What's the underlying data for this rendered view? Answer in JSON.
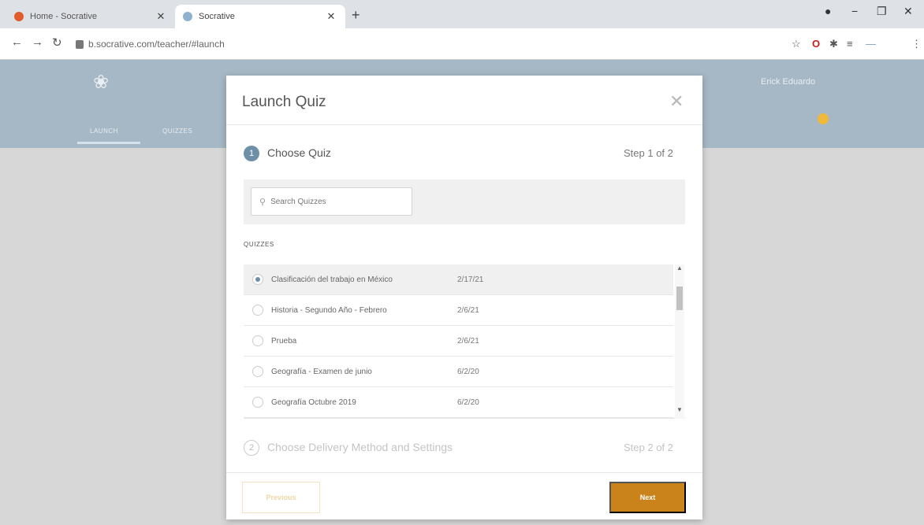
{
  "browser": {
    "tabs": [
      {
        "title": "Home - Socrative",
        "favicon_color": "#e05c2c"
      },
      {
        "title": "Socrative",
        "favicon_color": "#8fb3cf"
      }
    ],
    "url": "b.socrative.com/teacher/#launch"
  },
  "app": {
    "nav": {
      "launch_label": "LAUNCH",
      "quizzes_label": "QUIZZES"
    },
    "user": {
      "name": "Erick Eduardo"
    }
  },
  "modal": {
    "title": "Launch Quiz",
    "step1": {
      "number": "1",
      "label": "Choose Quiz",
      "counter": "Step 1 of 2"
    },
    "search": {
      "placeholder": "Search Quizzes"
    },
    "quizzes_heading": "QUIZZES",
    "quizzes": [
      {
        "name": "Clasificación del trabajo en México",
        "date": "2/17/21",
        "selected": true
      },
      {
        "name": "Historia - Segundo Año - Febrero",
        "date": "2/6/21",
        "selected": false
      },
      {
        "name": "Prueba",
        "date": "2/6/21",
        "selected": false
      },
      {
        "name": "Geografía - Examen de junio",
        "date": "6/2/20",
        "selected": false
      },
      {
        "name": "Geografía Octubre 2019",
        "date": "6/2/20",
        "selected": false
      }
    ],
    "step2": {
      "number": "2",
      "label": "Choose Delivery Method and Settings",
      "counter": "Step 2 of 2"
    },
    "previous_label": "Previous",
    "next_label": "Next"
  },
  "colors": {
    "accent": "#c9831a",
    "header": "#a6b8c5",
    "step_active": "#6e8fa8"
  }
}
